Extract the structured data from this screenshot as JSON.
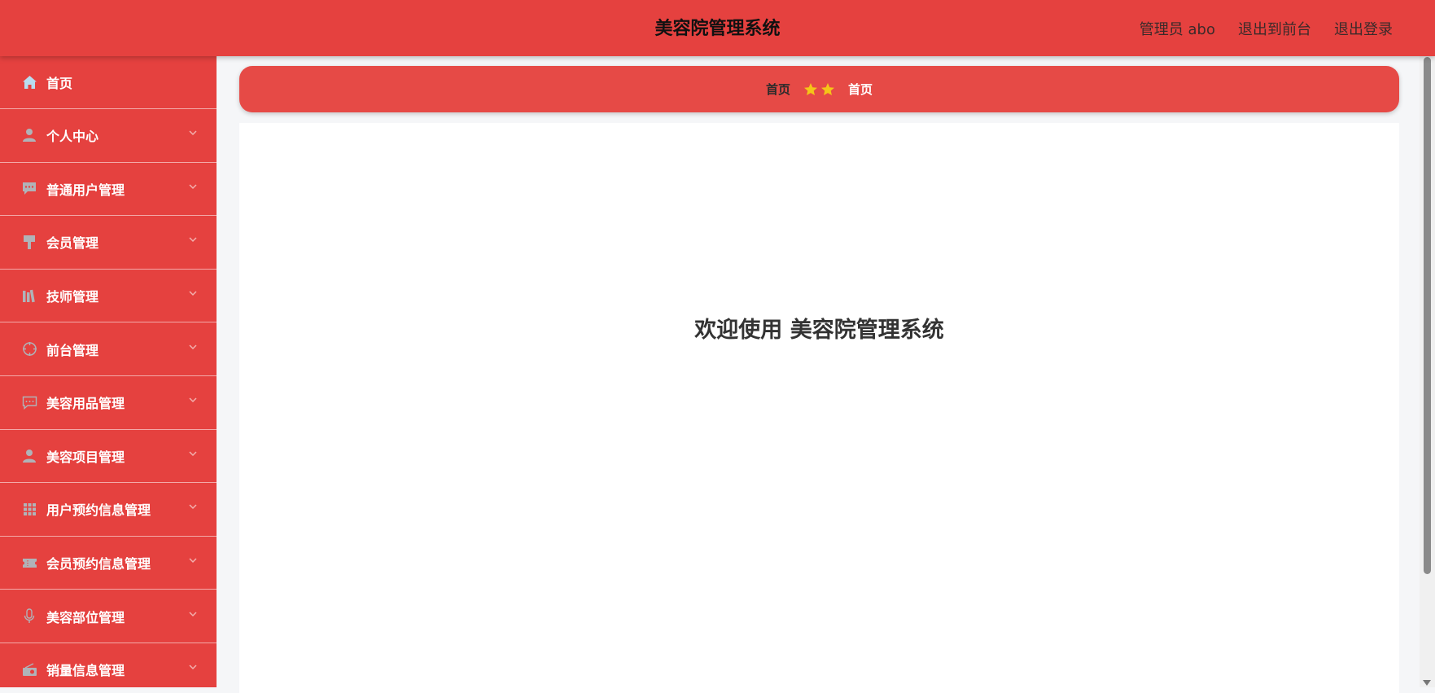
{
  "header": {
    "title": "美容院管理系统",
    "user": "管理员 abo",
    "front_link": "退出到前台",
    "logout": "退出登录"
  },
  "sidebar": {
    "items": [
      {
        "label": "首页",
        "icon": "home-icon"
      },
      {
        "label": "个人中心",
        "icon": "user-icon"
      },
      {
        "label": "普通用户管理",
        "icon": "chat-icon"
      },
      {
        "label": "会员管理",
        "icon": "brush-icon"
      },
      {
        "label": "技师管理",
        "icon": "library-icon"
      },
      {
        "label": "前台管理",
        "icon": "target-icon"
      },
      {
        "label": "美容用品管理",
        "icon": "message-icon"
      },
      {
        "label": "美容项目管理",
        "icon": "user-icon"
      },
      {
        "label": "用户预约信息管理",
        "icon": "grid-icon"
      },
      {
        "label": "会员预约信息管理",
        "icon": "ticket-icon"
      },
      {
        "label": "美容部位管理",
        "icon": "microphone-icon"
      },
      {
        "label": "销量信息管理",
        "icon": "radio-icon"
      }
    ]
  },
  "breadcrumb": {
    "home": "首页",
    "current": "首页"
  },
  "welcome": "欢迎使用 美容院管理系统",
  "colors": {
    "primary": "#e5413f",
    "breadcrumb_bg": "#e64a46",
    "star": "#f5c518",
    "icon_gray": "#b0b3b8"
  }
}
